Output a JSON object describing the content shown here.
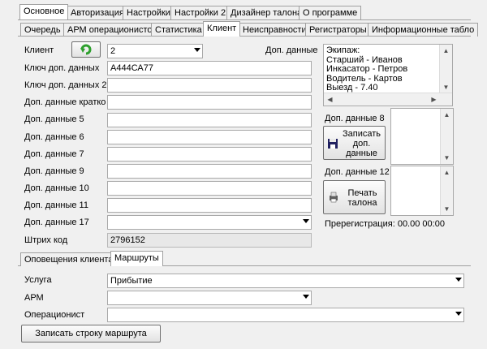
{
  "top_tabs": [
    "Основное",
    "Авторизация",
    "Настройки",
    "Настройки 2",
    "Дизайнер талона",
    "О программе"
  ],
  "sub_tabs": [
    "Очередь",
    "АРМ операционистов",
    "Статистика",
    "Клиент",
    "Неисправности",
    "Регистраторы",
    "Информационные табло"
  ],
  "client": {
    "client_label": "Клиент",
    "client_value": "2",
    "dop_label": "Доп. данные",
    "fields": [
      {
        "label": "Ключ доп. данных",
        "value": "А444СА77"
      },
      {
        "label": "Ключ доп. данных 2",
        "value": ""
      },
      {
        "label": "Доп. данные кратко",
        "value": ""
      },
      {
        "label": "Доп. данные 5",
        "value": ""
      },
      {
        "label": "Доп. данные 6",
        "value": ""
      },
      {
        "label": "Доп. данные 7",
        "value": ""
      },
      {
        "label": "Доп. данные 9",
        "value": ""
      },
      {
        "label": "Доп. данные 10",
        "value": ""
      },
      {
        "label": "Доп. данные 11",
        "value": ""
      }
    ],
    "dop17_label": "Доп. данные 17",
    "dop17_value": "",
    "barcode_label": "Штрих код",
    "barcode_value": "2796152",
    "memo": "Экипаж:\nСтарший - Иванов\nИнкасатор - Петров\nВодитель - Картов\nВыезд - 7.40",
    "dop8_label": "Доп. данные 8",
    "dop12_label": "Доп. данные 12",
    "write_btn": "Записать\nдоп.\nданные",
    "print_btn": "Печать\nталона",
    "prereg": "Пререгистрация: 00.00 00:00"
  },
  "bottom_tabs": [
    "Оповещения клиента",
    "Маршруты"
  ],
  "routes": {
    "service_label": "Услуга",
    "service_value": "Прибытие",
    "arm_label": "АРМ",
    "arm_value": "",
    "operator_label": "Операционист",
    "operator_value": "",
    "save_btn": "Записать строку маршрута"
  },
  "colors": {
    "refresh_icon": "#2ea02e",
    "tab_border": "#a0a0a0"
  }
}
